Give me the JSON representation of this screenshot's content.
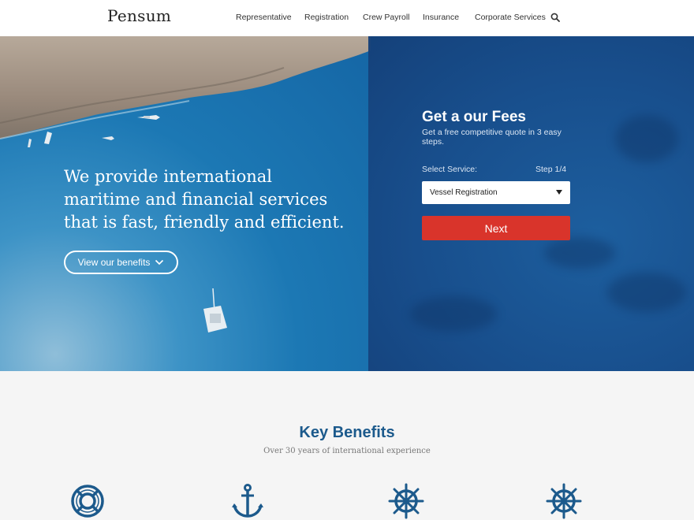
{
  "header": {
    "logo": "Pensum",
    "nav": [
      "Representative",
      "Registration",
      "Crew Payroll",
      "Insurance",
      "Corporate Services"
    ],
    "search_icon": "search-icon"
  },
  "hero": {
    "headline": "We provide international maritime and financial services that is fast, friendly and efficient.",
    "benefits_button": "View our benefits",
    "benefits_icon": "chevron-down-icon"
  },
  "quote_form": {
    "title": "Get a our Fees",
    "subtitle": "Get a free competitive quote in 3 easy steps.",
    "select_label": "Select Service:",
    "step": "Step 1/4",
    "selected_service": "Vessel Registration",
    "next_button": "Next"
  },
  "benefits": {
    "title": "Key Benefits",
    "subtitle": "Over 30 years of international experience",
    "icons": [
      "lifebuoy-icon",
      "anchor-icon",
      "ship-wheel-icon",
      "ship-wheel-icon"
    ]
  },
  "colors": {
    "accent_blue": "#1c5a8c",
    "next_red": "#d9342b"
  }
}
